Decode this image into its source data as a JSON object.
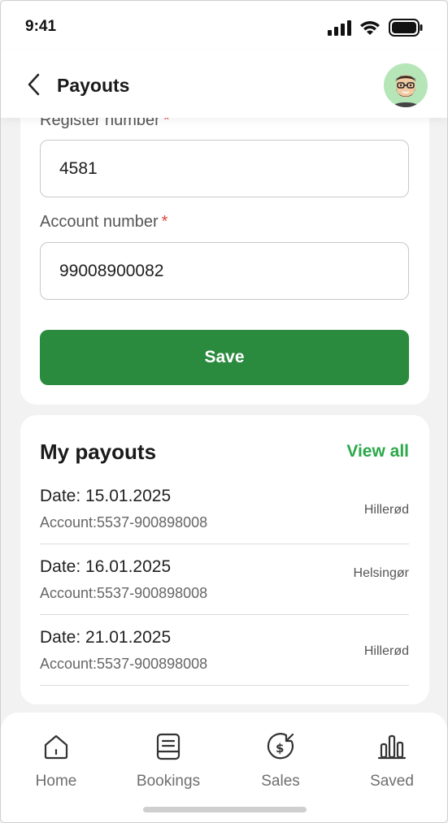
{
  "status": {
    "time": "9:41"
  },
  "header": {
    "title": "Payouts"
  },
  "form": {
    "register_label": "Register number",
    "register_value": "4581",
    "account_label": "Account number",
    "account_value": "99008900082",
    "required_mark": "*",
    "save_label": "Save"
  },
  "payouts": {
    "title": "My payouts",
    "view_all_label": "View all",
    "items": [
      {
        "date": "Date: 15.01.2025",
        "account": "Account:5537-900898008",
        "city": "Hillerød"
      },
      {
        "date": "Date: 16.01.2025",
        "account": "Account:5537-900898008",
        "city": "Helsingør"
      },
      {
        "date": "Date: 21.01.2025",
        "account": "Account:5537-900898008",
        "city": "Hillerød"
      }
    ]
  },
  "nav": {
    "items": [
      {
        "label": "Home",
        "icon": "home-icon"
      },
      {
        "label": "Bookings",
        "icon": "bookings-icon"
      },
      {
        "label": "Sales",
        "icon": "sales-icon"
      },
      {
        "label": "Saved",
        "icon": "saved-icon"
      }
    ]
  },
  "colors": {
    "accent": "#2a8a3e",
    "link": "#2aa84a",
    "required": "#e0443e"
  }
}
